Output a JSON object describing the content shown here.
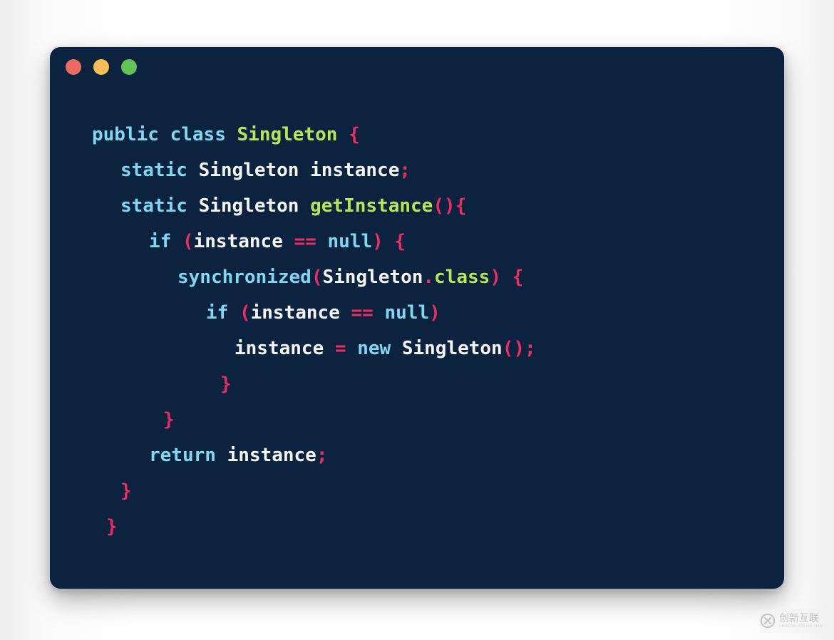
{
  "window": {
    "background_color": "#0c2340",
    "traffic_lights": [
      {
        "name": "close",
        "color": "#ec6a5e"
      },
      {
        "name": "minimize",
        "color": "#f5bf4f"
      },
      {
        "name": "maximize",
        "color": "#61c454"
      }
    ]
  },
  "theme": {
    "keyword_color": "#7fd8ef",
    "type_color": "#b5e853",
    "identifier_color": "#f4f6f7",
    "punctuation_color": "#ef2b5f",
    "page_background": "#ffffff"
  },
  "code": {
    "language": "java",
    "plain_text": "public class Singleton {\n  static Singleton instance;\n  static Singleton getInstance(){\n    if (instance == null) {\n      synchronized(Singleton.class) {\n        if (instance == null)\n          instance = new Singleton();\n        }\n    }\n    return instance;\n  }\n}",
    "lines": [
      {
        "indent": 0,
        "tokens": [
          {
            "t": "public",
            "c": "kw"
          },
          {
            "t": " ",
            "c": "id"
          },
          {
            "t": "class",
            "c": "kw"
          },
          {
            "t": " ",
            "c": "id"
          },
          {
            "t": "Singleton",
            "c": "type"
          },
          {
            "t": " ",
            "c": "id"
          },
          {
            "t": "{",
            "c": "pun"
          }
        ]
      },
      {
        "indent": 2,
        "tokens": [
          {
            "t": "static",
            "c": "kw"
          },
          {
            "t": " ",
            "c": "id"
          },
          {
            "t": "Singleton",
            "c": "id"
          },
          {
            "t": " ",
            "c": "id"
          },
          {
            "t": "instance",
            "c": "id"
          },
          {
            "t": ";",
            "c": "pun"
          }
        ]
      },
      {
        "indent": 2,
        "tokens": [
          {
            "t": "static",
            "c": "kw"
          },
          {
            "t": " ",
            "c": "id"
          },
          {
            "t": "Singleton",
            "c": "id"
          },
          {
            "t": " ",
            "c": "id"
          },
          {
            "t": "getInstance",
            "c": "type"
          },
          {
            "t": "(){",
            "c": "pun"
          }
        ]
      },
      {
        "indent": 4,
        "tokens": [
          {
            "t": "if",
            "c": "kw"
          },
          {
            "t": " ",
            "c": "id"
          },
          {
            "t": "(",
            "c": "pun"
          },
          {
            "t": "instance",
            "c": "id"
          },
          {
            "t": " ",
            "c": "id"
          },
          {
            "t": "==",
            "c": "pun"
          },
          {
            "t": " ",
            "c": "id"
          },
          {
            "t": "null",
            "c": "kw"
          },
          {
            "t": ")",
            "c": "pun"
          },
          {
            "t": " ",
            "c": "id"
          },
          {
            "t": "{",
            "c": "pun"
          }
        ]
      },
      {
        "indent": 6,
        "tokens": [
          {
            "t": "synchronized",
            "c": "kw"
          },
          {
            "t": "(",
            "c": "pun"
          },
          {
            "t": "Singleton",
            "c": "id"
          },
          {
            "t": ".",
            "c": "pun"
          },
          {
            "t": "class",
            "c": "type"
          },
          {
            "t": ")",
            "c": "pun"
          },
          {
            "t": " ",
            "c": "id"
          },
          {
            "t": "{",
            "c": "pun"
          }
        ]
      },
      {
        "indent": 8,
        "tokens": [
          {
            "t": "if",
            "c": "kw"
          },
          {
            "t": " ",
            "c": "id"
          },
          {
            "t": "(",
            "c": "pun"
          },
          {
            "t": "instance",
            "c": "id"
          },
          {
            "t": " ",
            "c": "id"
          },
          {
            "t": "==",
            "c": "pun"
          },
          {
            "t": " ",
            "c": "id"
          },
          {
            "t": "null",
            "c": "kw"
          },
          {
            "t": ")",
            "c": "pun"
          }
        ]
      },
      {
        "indent": 10,
        "tokens": [
          {
            "t": "instance",
            "c": "id"
          },
          {
            "t": " ",
            "c": "id"
          },
          {
            "t": "=",
            "c": "pun"
          },
          {
            "t": " ",
            "c": "id"
          },
          {
            "t": "new",
            "c": "kw"
          },
          {
            "t": " ",
            "c": "id"
          },
          {
            "t": "Singleton",
            "c": "id"
          },
          {
            "t": "();",
            "c": "pun"
          }
        ]
      },
      {
        "indent": 9,
        "tokens": [
          {
            "t": "}",
            "c": "pun"
          }
        ]
      },
      {
        "indent": 5,
        "tokens": [
          {
            "t": "}",
            "c": "pun"
          }
        ]
      },
      {
        "indent": 4,
        "tokens": [
          {
            "t": "return",
            "c": "kw"
          },
          {
            "t": " ",
            "c": "id"
          },
          {
            "t": "instance",
            "c": "id"
          },
          {
            "t": ";",
            "c": "pun"
          }
        ]
      },
      {
        "indent": 2,
        "tokens": [
          {
            "t": "}",
            "c": "pun"
          }
        ]
      },
      {
        "indent": 1,
        "tokens": [
          {
            "t": "}",
            "c": "pun"
          }
        ]
      }
    ]
  },
  "watermark": {
    "cn_text": "创新互联",
    "pinyin_text": "CHUANG XIN HU LIAN",
    "logo_letter": "X"
  }
}
